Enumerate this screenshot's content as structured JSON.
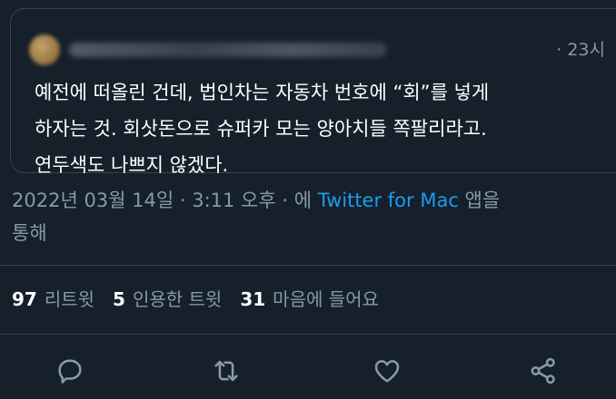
{
  "quote": {
    "time": "· 23시",
    "text": "예전에 떠올린 건데, 법인차는 자동차 번호에 “회”를 넣게\n하자는 것. 회삿돈으로 슈퍼카 모는 양아치들 쪽팔리라고.\n연두색도 나쁘지 않겠다."
  },
  "meta": {
    "date": "2022년 03월 14일 · 3:11 오후 · 에 ",
    "source": "Twitter for Mac",
    "suffix": " 앱을\n통해"
  },
  "stats": {
    "retweets_count": "97",
    "retweets_label": "리트윗",
    "quotes_count": "5",
    "quotes_label": "인용한 트윗",
    "likes_count": "31",
    "likes_label": "마음에 들어요"
  },
  "actions": [
    "reply-icon",
    "retweet-icon",
    "like-icon",
    "share-icon"
  ],
  "colors": {
    "background": "#15202b",
    "accent": "#1d9bf0",
    "muted": "#8899a6",
    "border": "#38444d"
  }
}
